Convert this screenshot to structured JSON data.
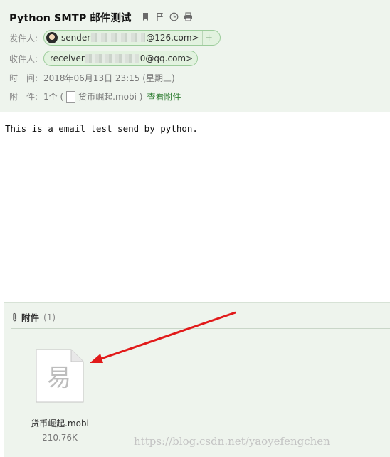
{
  "header": {
    "subject": "Python SMTP 邮件测试",
    "icons": [
      "bookmark-icon",
      "flag-icon",
      "clock-icon",
      "print-icon"
    ],
    "from_label": "发件人:",
    "from_name": "sender",
    "from_suffix": "@126.com>",
    "to_label": "收件人:",
    "to_name": "receiver",
    "to_suffix": "0@qq.com>",
    "time_label": "时　间:",
    "time_value": "2018年06月13日 23:15 (星期三)",
    "attach_label": "附　件:",
    "attach_count": "1个 (",
    "attach_file": "货币崛起.mobi )",
    "attach_link": "查看附件"
  },
  "body": {
    "text": "This is a email test send by python."
  },
  "attachments": {
    "title": "附件",
    "count": "(1)",
    "file_name": "货币崛起.mobi",
    "file_size": "210.76K",
    "file_glyph": "易"
  },
  "watermark": "https://blog.csdn.net/yaoyefengchen",
  "colors": {
    "header_bg": "#eef4ed",
    "chip_border": "#9ccc9b",
    "link": "#2f7d32",
    "arrow": "#e11a1a"
  }
}
